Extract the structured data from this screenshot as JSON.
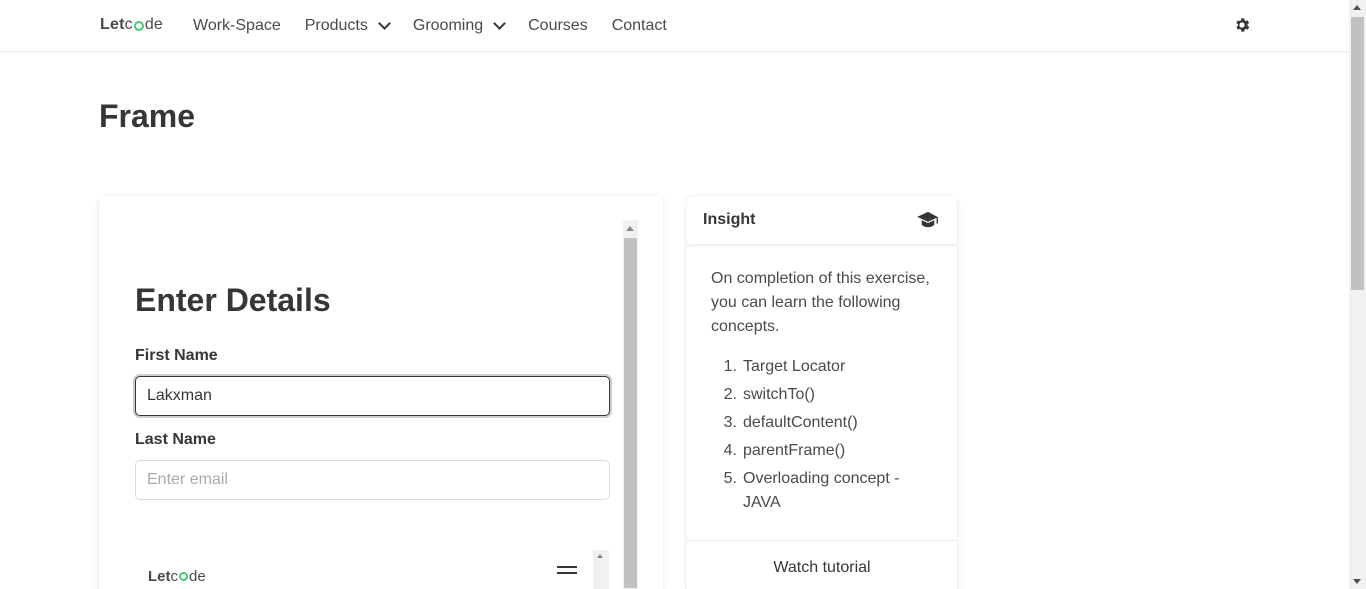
{
  "nav": {
    "brand_let": "Let",
    "brand_de": "de",
    "items": [
      {
        "label": "Work-Space"
      },
      {
        "label": "Products",
        "dropdown": true
      },
      {
        "label": "Grooming",
        "dropdown": true
      },
      {
        "label": "Courses"
      },
      {
        "label": "Contact"
      }
    ],
    "theme_icon": "gear-icon"
  },
  "page": {
    "title": "Frame"
  },
  "frame": {
    "form_title": "Enter Details",
    "first_name_label": "First Name",
    "first_name_value": "Lakxman",
    "last_name_label": "Last Name",
    "last_name_placeholder": "Enter email",
    "inner_brand_let": "Let",
    "inner_brand_de": "de",
    "menu_icon": "hamburger-icon"
  },
  "insight": {
    "title": "Insight",
    "icon": "graduation-cap-icon",
    "intro": "On completion of this exercise, you can learn the following concepts.",
    "concepts": [
      {
        "num": "1.",
        "text": "Target Locator"
      },
      {
        "num": "2.",
        "text": "switchTo()"
      },
      {
        "num": "3.",
        "text": "defaultContent()"
      },
      {
        "num": "4.",
        "text": "parentFrame()"
      },
      {
        "num": "5.",
        "text": "Overloading concept - JAVA"
      }
    ],
    "watch_label": "Watch tutorial"
  },
  "colors": {
    "accent_green": "#48c774",
    "text": "#363636"
  }
}
